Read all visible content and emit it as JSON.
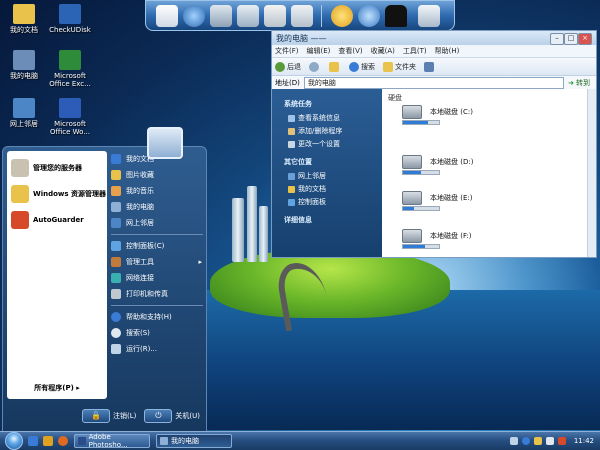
{
  "desktop": {
    "icons": [
      {
        "label": "我的文档",
        "icon": "folder-documents-icon",
        "color": "#e8c24a"
      },
      {
        "label": "CheckUDisk",
        "icon": "usb-disk-icon",
        "color": "#2b63b5"
      },
      {
        "label": "我的电脑",
        "icon": "computer-icon",
        "color": "#6c8db8"
      },
      {
        "label": "Microsoft Office Exc...",
        "icon": "excel-icon",
        "color": "#2e8b3a"
      },
      {
        "label": "网上邻居",
        "icon": "network-icon",
        "color": "#4c86c7"
      },
      {
        "label": "Microsoft Office Wo...",
        "icon": "word-icon",
        "color": "#2d5cb8"
      }
    ]
  },
  "dock": {
    "icons": [
      "notes-icon",
      "globe-icon",
      "folder-icon",
      "folder-open-icon",
      "gallery-icon",
      "tools-icon",
      "sun-icon",
      "network-globe-icon",
      "shirt-icon",
      "recycle-bin-icon"
    ]
  },
  "explorer": {
    "title": "我的电脑 ——",
    "menu": [
      "文件(F)",
      "编辑(E)",
      "查看(V)",
      "收藏(A)",
      "工具(T)",
      "帮助(H)"
    ],
    "toolbar": {
      "back": "后退",
      "search": "搜索",
      "folders": "文件夹"
    },
    "address": {
      "label": "地址(D)",
      "value": "我的电脑",
      "go": "转到"
    },
    "tasks": [
      {
        "heading": "系统任务",
        "items": [
          "查看系统信息",
          "添加/删除程序",
          "更改一个设置"
        ]
      },
      {
        "heading": "其它位置",
        "items": [
          "网上邻居",
          "我的文档",
          "控制面板"
        ]
      },
      {
        "heading": "详细信息",
        "items": []
      }
    ],
    "section_header": "硬盘",
    "drives": [
      {
        "label": "本地磁盘 (C:)",
        "free_fraction": 0.7
      },
      {
        "label": "本地磁盘 (D:)",
        "free_fraction": 0.5
      },
      {
        "label": "本地磁盘 (E:)",
        "free_fraction": 0.3
      },
      {
        "label": "本地磁盘 (F:)",
        "free_fraction": 0.6
      }
    ]
  },
  "start_menu": {
    "pinned": [
      {
        "label": "管理您的服务器",
        "icon": "server-icon",
        "color": "#c9c2b0"
      },
      {
        "label": "Windows 资源管理器",
        "icon": "explorer-icon",
        "color": "#e8c24a"
      },
      {
        "label": "AutoGuarder",
        "icon": "shield-icon",
        "color": "#d64a2a"
      }
    ],
    "all_programs": "所有程序(P)",
    "right_items": [
      {
        "label": "我的文档",
        "icon": "documents-icon",
        "color": "#3a7bd5"
      },
      {
        "label": "图片收藏",
        "icon": "pictures-icon",
        "color": "#e8c24a"
      },
      {
        "label": "我的音乐",
        "icon": "music-icon",
        "color": "#e8a04a"
      },
      {
        "label": "我的电脑",
        "icon": "computer-icon",
        "color": "#8fb0d4"
      },
      {
        "label": "网上邻居",
        "icon": "network-icon",
        "color": "#4c86c7"
      },
      {
        "label": "控制面板(C)",
        "icon": "control-panel-icon",
        "color": "#5fa3e0"
      },
      {
        "label": "管理工具",
        "icon": "admin-tools-icon",
        "color": "#c07a3a"
      },
      {
        "label": "网络连接",
        "icon": "network-connections-icon",
        "color": "#3ab0b0"
      },
      {
        "label": "打印机和传真",
        "icon": "printer-icon",
        "color": "#c0c8d0"
      },
      {
        "label": "帮助和支持(H)",
        "icon": "help-icon",
        "color": "#3a7bd5"
      },
      {
        "label": "搜索(S)",
        "icon": "search-icon",
        "color": "#e0e8f0"
      },
      {
        "label": "运行(R)...",
        "icon": "run-icon",
        "color": "#c0d4e8"
      }
    ],
    "logoff": "注销(L)",
    "shutdown": "关机(U)"
  },
  "taskbar": {
    "quick_launch": [
      "ie-icon",
      "media-icon",
      "firefox-icon"
    ],
    "buttons": [
      {
        "label": "Adobe Photosho...",
        "active": false
      },
      {
        "label": "我的电脑",
        "active": true
      }
    ],
    "tray": [
      "tray-network-icon",
      "tray-help-icon",
      "tray-shield-icon",
      "tray-volume-icon",
      "tray-security-icon"
    ],
    "clock": "11:42"
  },
  "colors": {
    "accent": "#2f5d90",
    "taskbar": "#274f82"
  }
}
